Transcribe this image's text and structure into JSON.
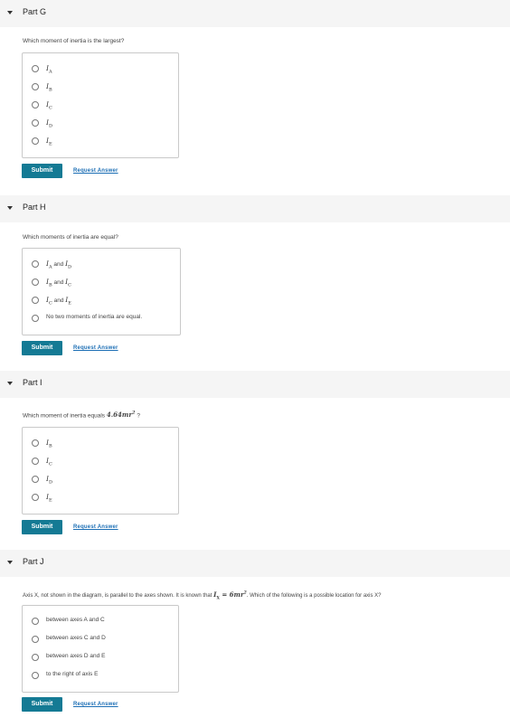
{
  "parts": {
    "g": {
      "title": "Part G",
      "question": "Which moment of inertia is the largest?",
      "options": [
        "I_A",
        "I_B",
        "I_C",
        "I_D",
        "I_E"
      ],
      "option_display": [
        "IA",
        "IB",
        "IC",
        "ID",
        "IE"
      ]
    },
    "h": {
      "title": "Part H",
      "question": "Which moments of inertia are equal?",
      "options": [
        "I_A and I_D",
        "I_B and I_C",
        "I_C and I_E",
        "No two moments of inertia are equal."
      ]
    },
    "i": {
      "title": "Part I",
      "question_prefix": "Which moment of inertia equals",
      "question_math": "4.64mr²",
      "question_suffix": "?",
      "options": [
        "I_B",
        "I_C",
        "I_D",
        "I_E"
      ]
    },
    "j": {
      "title": "Part J",
      "question_prefix": "Axis X, not shown in the diagram, is parallel to the axes shown. It is known that",
      "question_math": "I_X = 6mr²",
      "question_suffix": ". Which of the following is a possible location for axis X?",
      "options": [
        "between axes A and C",
        "between axes C and D",
        "between axes D and E",
        "to the right of axis E"
      ]
    }
  },
  "buttons": {
    "submit": "Submit",
    "request_answer": "Request Answer"
  },
  "colors": {
    "submit_bg": "#147a94",
    "link": "#1d6fb5",
    "header_bg": "#f5f5f5"
  }
}
